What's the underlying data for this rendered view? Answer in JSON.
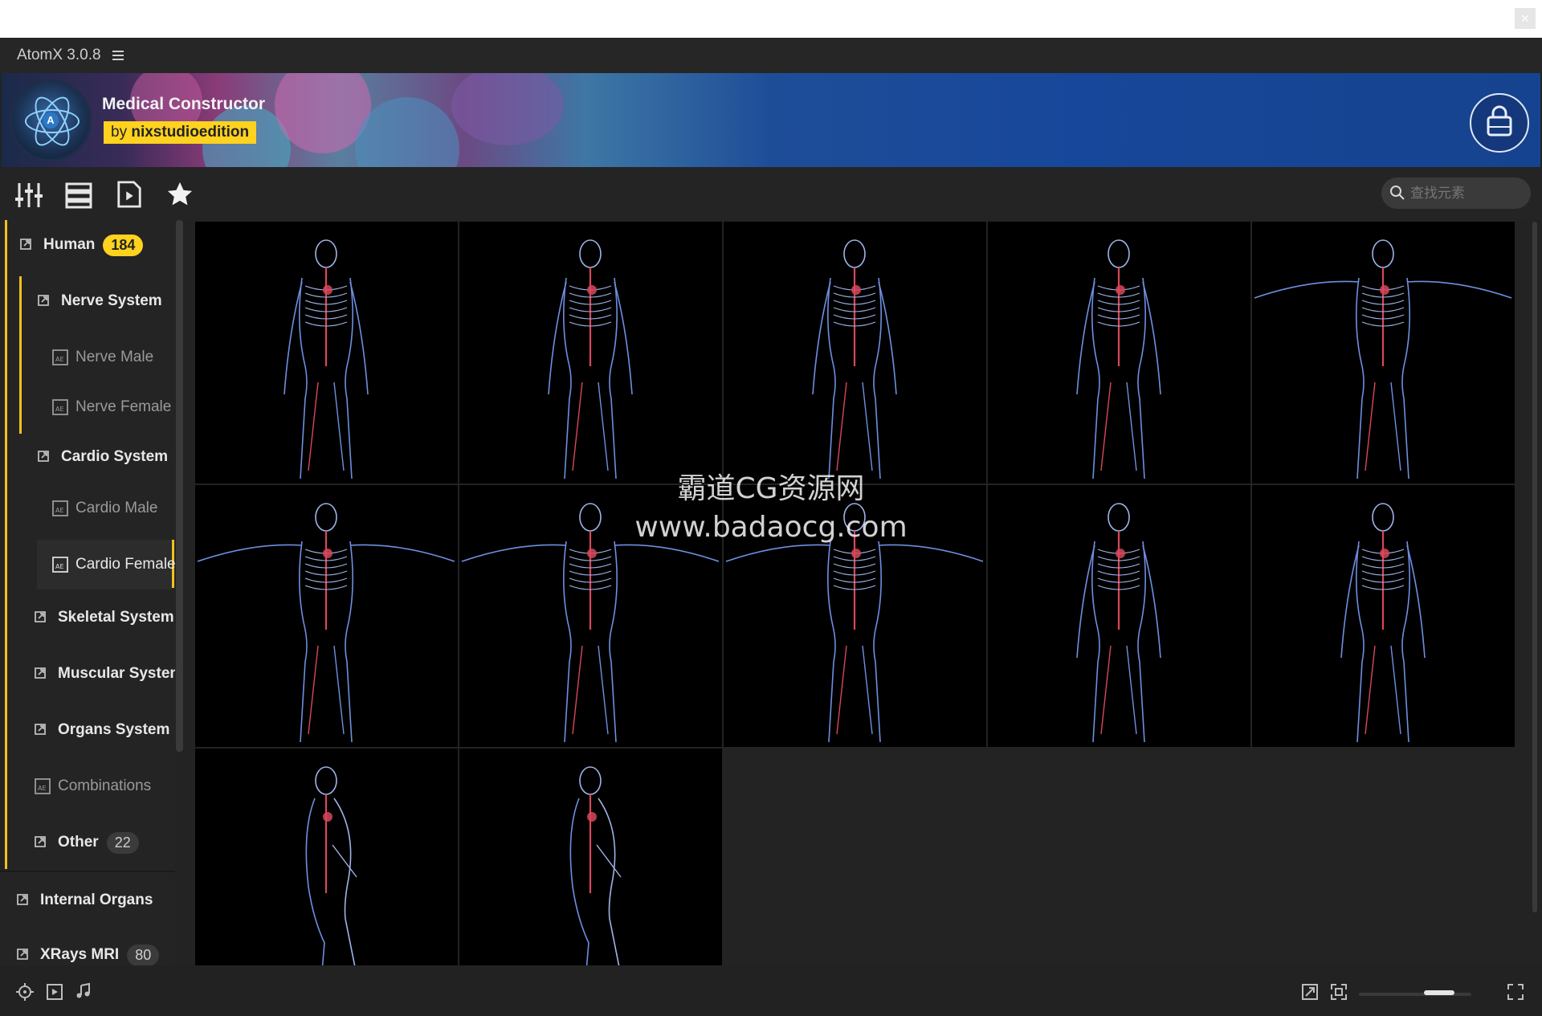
{
  "window": {
    "app_title": "AtomX 3.0.8"
  },
  "banner": {
    "title": "Medical Constructor",
    "author_prefix": "by",
    "author": "nixstudioedition"
  },
  "toolbar": {
    "icons": [
      "sliders-icon",
      "list-view-icon",
      "media-file-icon",
      "star-icon"
    ],
    "search_placeholder": "查找元素"
  },
  "sidebar": {
    "items": [
      {
        "label": "Human",
        "badge": "184",
        "type": "category"
      },
      {
        "label": "Nerve System",
        "type": "category"
      },
      {
        "label": "Nerve Male",
        "type": "preset"
      },
      {
        "label": "Nerve Female",
        "type": "preset"
      },
      {
        "label": "Cardio System",
        "type": "category"
      },
      {
        "label": "Cardio Male",
        "type": "preset"
      },
      {
        "label": "Cardio Female",
        "type": "preset"
      },
      {
        "label": "Skeletal System",
        "type": "category"
      },
      {
        "label": "Muscular System",
        "type": "category"
      },
      {
        "label": "Organs System",
        "type": "category"
      },
      {
        "label": "Combinations",
        "type": "preset"
      },
      {
        "label": "Other",
        "badge": "22",
        "type": "category"
      },
      {
        "label": "Internal Organs",
        "type": "category"
      },
      {
        "label": "XRays MRI",
        "badge": "80",
        "type": "category"
      }
    ]
  },
  "grid": {
    "thumbnail_count": 12
  },
  "watermark": {
    "line1": "霸道CG资源网",
    "line2": "www.badaocg.com"
  },
  "colors": {
    "accent": "#ffd21f",
    "banner_blue": "#16438f",
    "background": "#232323"
  }
}
